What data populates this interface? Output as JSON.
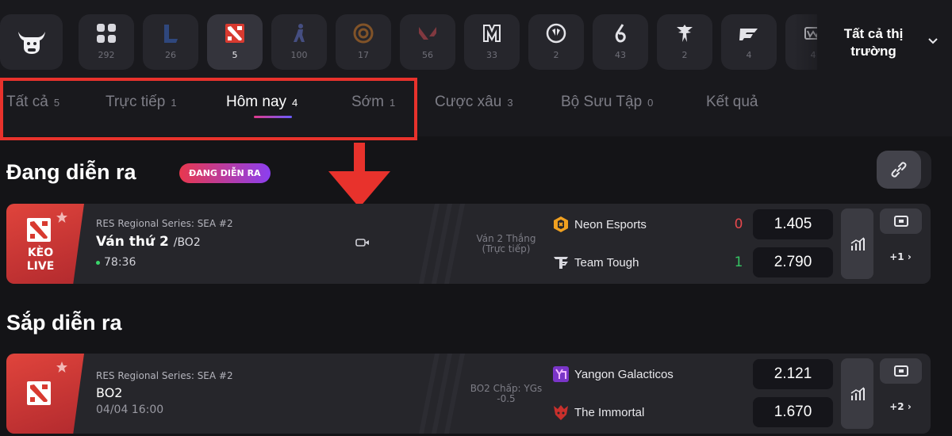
{
  "games": [
    {
      "name": "all-games",
      "count": "292"
    },
    {
      "name": "league-of-legends",
      "count": "26"
    },
    {
      "name": "dota-2",
      "count": "5",
      "active": true
    },
    {
      "name": "counter-strike",
      "count": "100"
    },
    {
      "name": "king-of-glory",
      "count": "17"
    },
    {
      "name": "valorant",
      "count": "56"
    },
    {
      "name": "mobile-legends",
      "count": "33"
    },
    {
      "name": "overwatch",
      "count": "2"
    },
    {
      "name": "rainbow-six",
      "count": "43"
    },
    {
      "name": "starcraft",
      "count": "2"
    },
    {
      "name": "crossfire",
      "count": "4"
    },
    {
      "name": "warcraft",
      "count": "4"
    }
  ],
  "market_filter": {
    "label": "Tất cả thị trường"
  },
  "tabs": [
    {
      "label": "Tất cả",
      "count": "5"
    },
    {
      "label": "Trực tiếp",
      "count": "1"
    },
    {
      "label": "Hôm nay",
      "count": "4",
      "active": true
    },
    {
      "label": "Sớm",
      "count": "1"
    },
    {
      "label": "Cược xâu",
      "count": "3"
    },
    {
      "label": "Bộ Sưu Tập",
      "count": "0"
    },
    {
      "label": "Kết quả",
      "count": ""
    }
  ],
  "live_section": {
    "title": "Đang diễn ra",
    "pill": "ĐANG DIỄN RA",
    "match": {
      "badge": "KÈO\nLIVE",
      "league": "RES Regional Series: SEA #2",
      "title": "Ván thứ 2",
      "format": "/BO2",
      "time": "78:36",
      "market": "Ván 2 Thắng",
      "market_note": "(Trực tiếp)",
      "teams": [
        {
          "name": "Neon Esports",
          "score": "0",
          "odd": "1.405"
        },
        {
          "name": "Team Tough",
          "score": "1",
          "odd": "2.790"
        }
      ],
      "more": "+1 ›"
    }
  },
  "upcoming_section": {
    "title": "Sắp diễn ra",
    "match": {
      "league": "RES Regional Series: SEA #2",
      "title": "BO2",
      "time": "04/04 16:00",
      "market": "BO2 Chấp: YGs",
      "market_note": "-0.5",
      "teams": [
        {
          "name": "Yangon Galacticos",
          "odd": "2.121"
        },
        {
          "name": "The Immortal",
          "odd": "1.670"
        }
      ],
      "more": "+2 ›"
    }
  },
  "colors": {
    "accent_red": "#e8322c",
    "live_score_red": "#e5484d",
    "live_score_green": "#35c464"
  }
}
